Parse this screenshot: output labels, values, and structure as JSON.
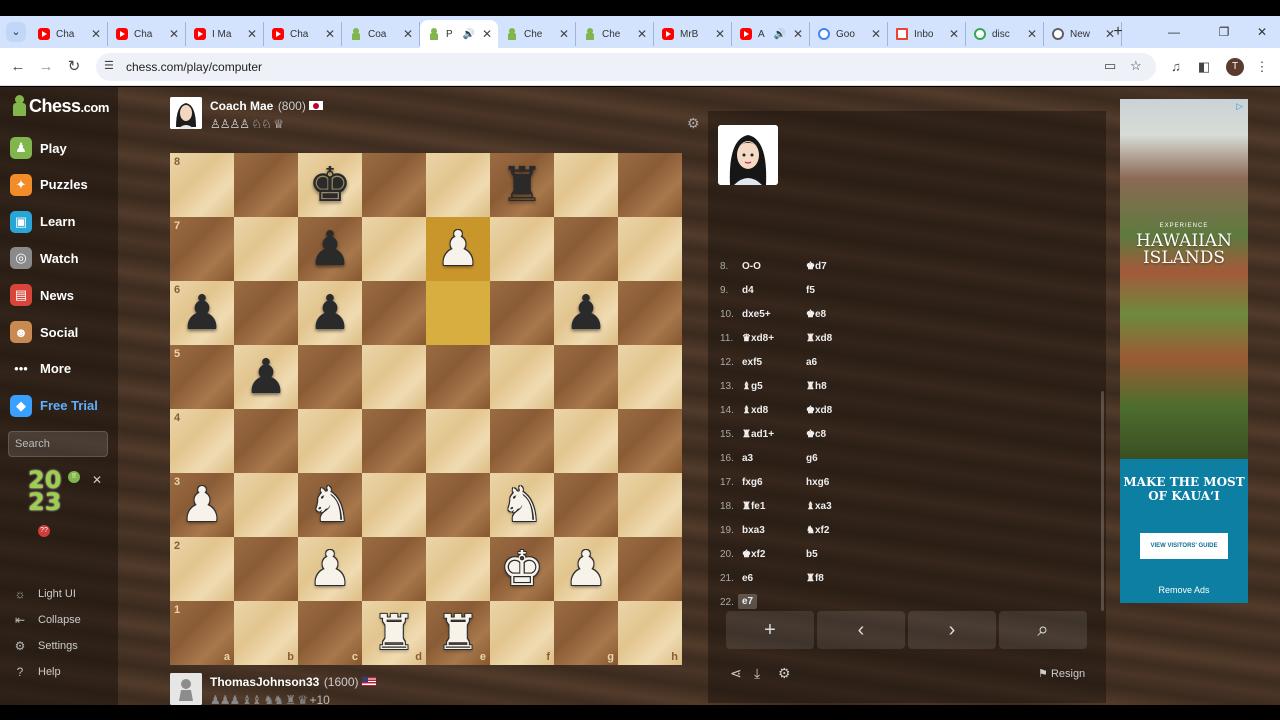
{
  "browser": {
    "tabs": [
      {
        "label": "Cha",
        "icon": "youtube-icon",
        "kind": "yt",
        "left": 0
      },
      {
        "label": "Cha",
        "icon": "youtube-icon",
        "kind": "yt"
      },
      {
        "label": "I Ma",
        "icon": "youtube-icon",
        "kind": "yt"
      },
      {
        "label": "Cha",
        "icon": "youtube-icon",
        "kind": "yt"
      },
      {
        "label": "Coa",
        "icon": "chess-com-icon",
        "kind": "chess"
      },
      {
        "label": "P",
        "icon": "chess-com-icon",
        "kind": "chess",
        "active": true,
        "speaker": true
      },
      {
        "label": "Che",
        "icon": "chess-com-icon",
        "kind": "chess"
      },
      {
        "label": "Che",
        "icon": "chess-com-icon",
        "kind": "chess"
      },
      {
        "label": "MrB",
        "icon": "youtube-icon",
        "kind": "yt"
      },
      {
        "label": "A",
        "icon": "youtube-icon",
        "kind": "yt",
        "speaker": true
      },
      {
        "label": "Goo",
        "icon": "google-icon",
        "kind": "goo"
      },
      {
        "label": "Inbo",
        "icon": "gmail-icon",
        "kind": "gmail"
      },
      {
        "label": "disc",
        "icon": "google-icon",
        "kind": "google"
      },
      {
        "label": "New",
        "icon": "globe-icon",
        "kind": "globe"
      }
    ],
    "url": "chess.com/play/computer",
    "profile_initial": "T"
  },
  "sidebar": {
    "logo_main": "Chess",
    "logo_suffix": ".com",
    "items": [
      {
        "label": "Play",
        "icon": "play-icon",
        "color": "#81b64c",
        "glyph": "♟"
      },
      {
        "label": "Puzzles",
        "icon": "puzzle-icon",
        "color": "#f28c28",
        "glyph": "✦"
      },
      {
        "label": "Learn",
        "icon": "learn-icon",
        "color": "#2aa6d6",
        "glyph": "▣"
      },
      {
        "label": "Watch",
        "icon": "binoculars-icon",
        "color": "#8a8a8a",
        "glyph": "◎"
      },
      {
        "label": "News",
        "icon": "news-icon",
        "color": "#d9443b",
        "glyph": "▤"
      },
      {
        "label": "Social",
        "icon": "social-icon",
        "color": "#c98a52",
        "glyph": "☻"
      },
      {
        "label": "More",
        "icon": "more-icon",
        "color": "transparent",
        "glyph": "•••"
      },
      {
        "label": "Free Trial",
        "icon": "diamond-icon",
        "color": "#3aa0ff",
        "glyph": "◆"
      }
    ],
    "search_placeholder": "Search",
    "promo_year_top": "20",
    "promo_year_bottom": "23",
    "promo_badge_top": "!!",
    "promo_badge_bottom": "??",
    "bottom_items": [
      {
        "label": "Light UI",
        "icon": "sun-icon",
        "glyph": "☼"
      },
      {
        "label": "Collapse",
        "icon": "collapse-icon",
        "glyph": "⇤"
      },
      {
        "label": "Settings",
        "icon": "gear-icon",
        "glyph": "⚙"
      },
      {
        "label": "Help",
        "icon": "help-icon",
        "glyph": "?"
      }
    ]
  },
  "opponent": {
    "name": "Coach Mae",
    "rating": "(800)",
    "captured": "♙♙♙♙ ♘♘ ♕"
  },
  "player": {
    "name": "ThomasJohnson33",
    "rating": "(1600)",
    "captured": "♟♟♟ ♝♝ ♞♞ ♜ ♛",
    "advantage": "+10"
  },
  "board": {
    "files": [
      "a",
      "b",
      "c",
      "d",
      "e",
      "f",
      "g",
      "h"
    ],
    "ranks": [
      "8",
      "7",
      "6",
      "5",
      "4",
      "3",
      "2",
      "1"
    ],
    "highlight": [
      "e7",
      "e6"
    ],
    "pieces": [
      {
        "sq": "c8",
        "glyph": "♚",
        "color": "b"
      },
      {
        "sq": "f8",
        "glyph": "♜",
        "color": "b"
      },
      {
        "sq": "c7",
        "glyph": "♟",
        "color": "b"
      },
      {
        "sq": "e7",
        "glyph": "♟",
        "color": "w"
      },
      {
        "sq": "a6",
        "glyph": "♟",
        "color": "b"
      },
      {
        "sq": "c6",
        "glyph": "♟",
        "color": "b"
      },
      {
        "sq": "g6",
        "glyph": "♟",
        "color": "b"
      },
      {
        "sq": "b5",
        "glyph": "♟",
        "color": "b"
      },
      {
        "sq": "a3",
        "glyph": "♟",
        "color": "w"
      },
      {
        "sq": "c3",
        "glyph": "♞",
        "color": "w"
      },
      {
        "sq": "f3",
        "glyph": "♞",
        "color": "w"
      },
      {
        "sq": "c2",
        "glyph": "♟",
        "color": "w"
      },
      {
        "sq": "f2",
        "glyph": "♚",
        "color": "w"
      },
      {
        "sq": "g2",
        "glyph": "♟",
        "color": "w"
      },
      {
        "sq": "d1",
        "glyph": "♜",
        "color": "w"
      },
      {
        "sq": "e1",
        "glyph": "♜",
        "color": "w"
      }
    ]
  },
  "moves": [
    {
      "n": "8.",
      "w": "O-O",
      "b": "♚d7"
    },
    {
      "n": "9.",
      "w": "d4",
      "b": "f5"
    },
    {
      "n": "10.",
      "w": "dxe5+",
      "b": "♚e8"
    },
    {
      "n": "11.",
      "w": "♛xd8+",
      "b": "♜xd8"
    },
    {
      "n": "12.",
      "w": "exf5",
      "b": "a6"
    },
    {
      "n": "13.",
      "w": "♝g5",
      "b": "♜h8"
    },
    {
      "n": "14.",
      "w": "♝xd8",
      "b": "♚xd8"
    },
    {
      "n": "15.",
      "w": "♜ad1+",
      "b": "♚c8"
    },
    {
      "n": "16.",
      "w": "a3",
      "b": "g6"
    },
    {
      "n": "17.",
      "w": "fxg6",
      "b": "hxg6"
    },
    {
      "n": "18.",
      "w": "♜fe1",
      "b": "♝xa3"
    },
    {
      "n": "19.",
      "w": "bxa3",
      "b": "♞xf2"
    },
    {
      "n": "20.",
      "w": "♚xf2",
      "b": "b5"
    },
    {
      "n": "21.",
      "w": "e6",
      "b": "♜f8"
    },
    {
      "n": "22.",
      "w": "e7",
      "b": ""
    }
  ],
  "controls": {
    "add": "+",
    "prev": "‹",
    "next": "›",
    "analyze": "⌕",
    "resign": "Resign"
  },
  "ad": {
    "experience": "EXPERIENCE",
    "title": "HAWAIIAN ISLANDS",
    "make": "MAKE THE MOST OF KAUAʻI",
    "button": "VIEW VISITORS' GUIDE",
    "remove": "Remove Ads"
  }
}
